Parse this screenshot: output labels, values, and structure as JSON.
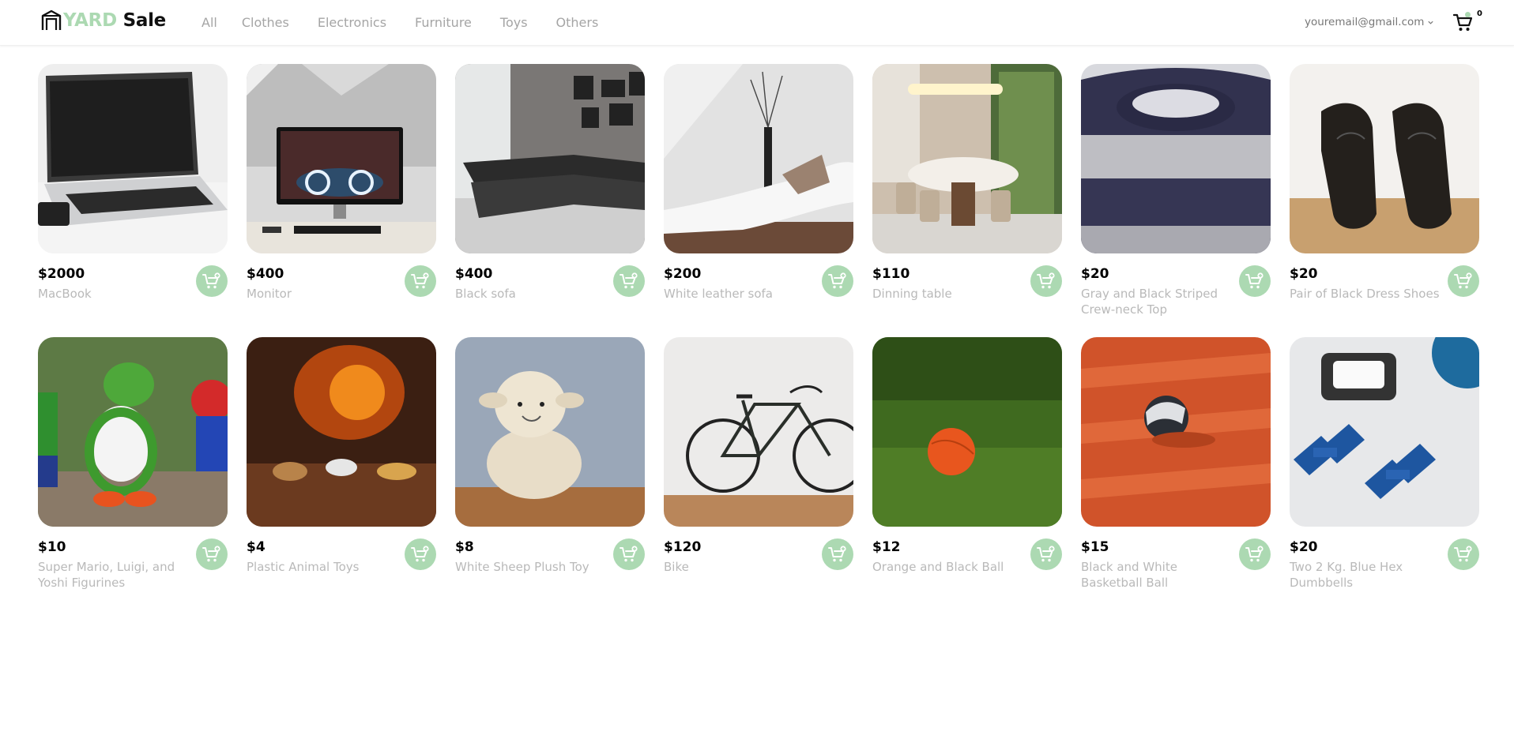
{
  "brand": {
    "yard": "YARD",
    "sale": "Sale"
  },
  "nav": {
    "categories": [
      "All",
      "Clothes",
      "Electronics",
      "Furniture",
      "Toys",
      "Others"
    ]
  },
  "account": {
    "email": "youremail@gmail.com"
  },
  "cart": {
    "count": "0"
  },
  "colors": {
    "accent": "#acd9b2",
    "muted_text": "#b9b9b9",
    "nav_text": "#a5a5a5"
  },
  "products": [
    {
      "price": "$2000",
      "name": "MacBook",
      "image": "laptop-photo"
    },
    {
      "price": "$400",
      "name": "Monitor",
      "image": "desktop-monitor-photo"
    },
    {
      "price": "$400",
      "name": "Black sofa",
      "image": "black-sofa-photo"
    },
    {
      "price": "$200",
      "name": "White leather sofa",
      "image": "white-sofa-photo"
    },
    {
      "price": "$110",
      "name": "Dinning table",
      "image": "dining-table-photo"
    },
    {
      "price": "$20",
      "name": "Gray and Black Striped Crew-neck Top",
      "image": "striped-sweater-photo"
    },
    {
      "price": "$20",
      "name": "Pair of Black Dress Shoes",
      "image": "dress-shoes-photo"
    },
    {
      "price": "$10",
      "name": "Super Mario, Luigi, and Yoshi Figurines",
      "image": "figurines-photo"
    },
    {
      "price": "$4",
      "name": "Plastic Animal Toys",
      "image": "animal-toys-photo"
    },
    {
      "price": "$8",
      "name": "White Sheep Plush Toy",
      "image": "sheep-plush-photo"
    },
    {
      "price": "$120",
      "name": "Bike",
      "image": "bike-photo"
    },
    {
      "price": "$12",
      "name": "Orange and Black Ball",
      "image": "orange-ball-photo"
    },
    {
      "price": "$15",
      "name": "Black and White Basketball Ball",
      "image": "basketball-photo"
    },
    {
      "price": "$20",
      "name": "Two 2 Kg. Blue Hex Dumbbells",
      "image": "dumbbells-photo"
    }
  ]
}
